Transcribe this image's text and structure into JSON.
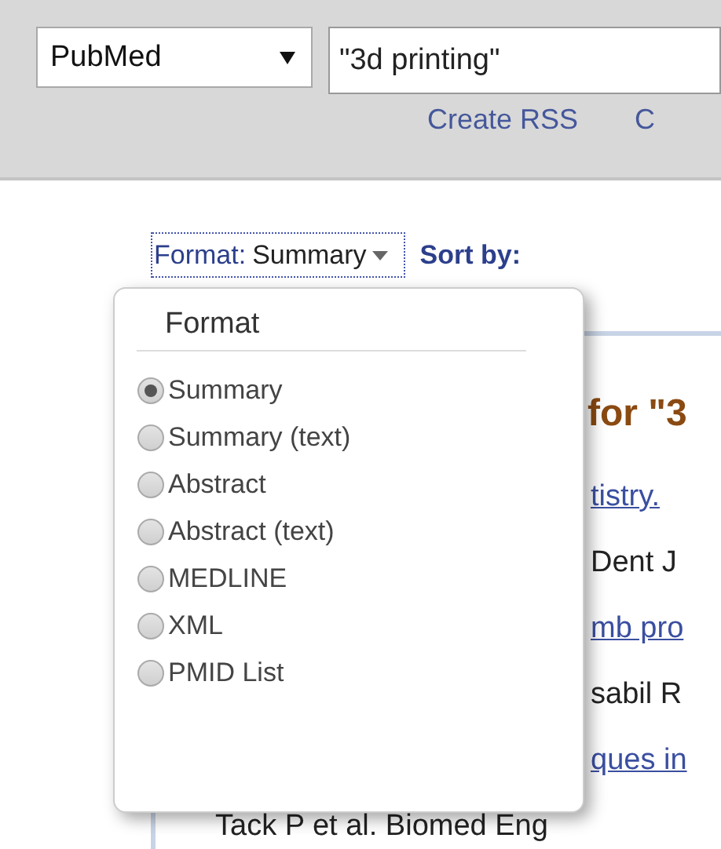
{
  "search_bar": {
    "database": "PubMed",
    "query": "\"3d printing\"",
    "links": [
      "Create RSS",
      "C"
    ]
  },
  "display_bar": {
    "format_label": "Format:",
    "format_value": "Summary",
    "sort_label": "Sort by:"
  },
  "format_menu": {
    "title": "Format",
    "options": [
      {
        "label": "Summary",
        "selected": true
      },
      {
        "label": "Summary (text)",
        "selected": false
      },
      {
        "label": "Abstract",
        "selected": false
      },
      {
        "label": "Abstract (text)",
        "selected": false
      },
      {
        "label": "MEDLINE",
        "selected": false
      },
      {
        "label": "XML",
        "selected": false
      },
      {
        "label": "PMID List",
        "selected": false
      }
    ]
  },
  "results": {
    "heading": "for \"3",
    "lines": [
      {
        "kind": "link",
        "text": "tistry."
      },
      {
        "kind": "text",
        "text": "Dent J"
      },
      {
        "kind": "link",
        "text": "mb pro"
      },
      {
        "kind": "text",
        "text": "sabil R"
      },
      {
        "kind": "link",
        "text": "ques in"
      },
      {
        "kind": "wide",
        "text": "Tack P   et al. Biomed Eng"
      }
    ]
  }
}
